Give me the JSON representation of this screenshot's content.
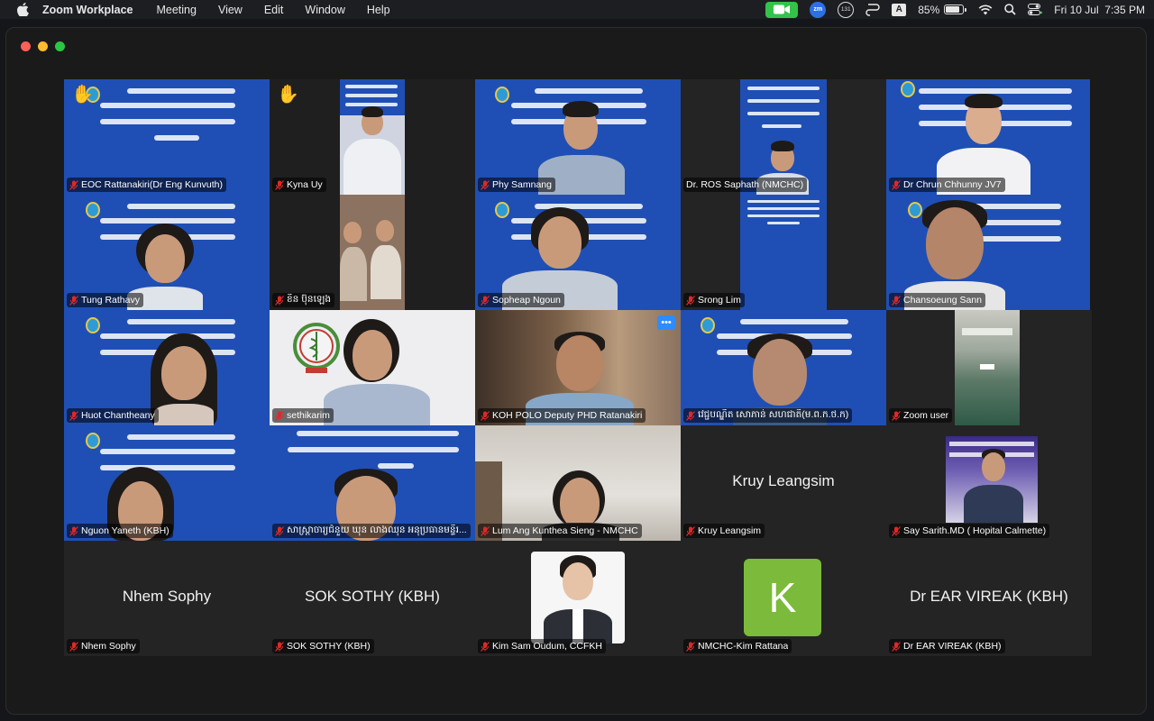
{
  "menubar": {
    "app_name": "Zoom Workplace",
    "menus": [
      "Meeting",
      "View",
      "Edit",
      "Window",
      "Help"
    ],
    "zoom_badge": "zm",
    "notification_count": "131",
    "input_source": "A",
    "battery_percent": "85%",
    "battery_level": 0.85,
    "datetime": "Fri 10 Jul  7:35 PM"
  },
  "colors": {
    "accent_green": "#3ccf4e",
    "banner_blue": "#1f4fb5",
    "avatar_green": "#7cba3b",
    "muted_red": "#e02828"
  },
  "participants": [
    {
      "name": "EOC Rattanakiri(Dr Eng Kunvuth)",
      "hand_raised": true,
      "active_speaker": true
    },
    {
      "name": "Kyna Uy",
      "hand_raised": true
    },
    {
      "name": "Phy Samnang"
    },
    {
      "name": "Dr. ROS Saphath (NMCHC)"
    },
    {
      "name": "Dr Chrun Chhunny JV7"
    },
    {
      "name": "Tung Rathavy"
    },
    {
      "name": "ខិន ប៊ុនឡេង"
    },
    {
      "name": "Sopheap Ngoun"
    },
    {
      "name": "Srong Lim"
    },
    {
      "name": "Chansoeung Sann"
    },
    {
      "name": "Huot Chantheany"
    },
    {
      "name": "sethikarim"
    },
    {
      "name": "KOH POLO Deputy PHD Ratanakiri",
      "more_button": "•••"
    },
    {
      "name": "វេជ្ជបណ្ឌិត សោភាន់ សហជាតិ(ម.ព.ក.ថ.ក)"
    },
    {
      "name": "Zoom user"
    },
    {
      "name": "Nguon Yaneth (KBH)"
    },
    {
      "name": "សាស្រ្តាចារ្យជំនួយ ឃុន លាងឈុន អនុប្រធានមន្ទីរ..."
    },
    {
      "name": "Lum Ang Kunthea Sieng - NMCHC"
    },
    {
      "name": "Kruy Leangsim",
      "display_text": "Kruy Leangsim"
    },
    {
      "name": "Say Sarith.MD ( Hopital Calmette)"
    },
    {
      "name": "Nhem Sophy",
      "display_text": "Nhem Sophy"
    },
    {
      "name": "SOK SOTHY (KBH)",
      "display_text": "SOK SOTHY (KBH)"
    },
    {
      "name": "Kim Sam Oudum, CCFKH"
    },
    {
      "name": "NMCHC-Kim Rattana",
      "avatar_letter": "K"
    },
    {
      "name": "Dr EAR VIREAK (KBH)",
      "display_text": "Dr EAR VIREAK (KBH)"
    }
  ]
}
